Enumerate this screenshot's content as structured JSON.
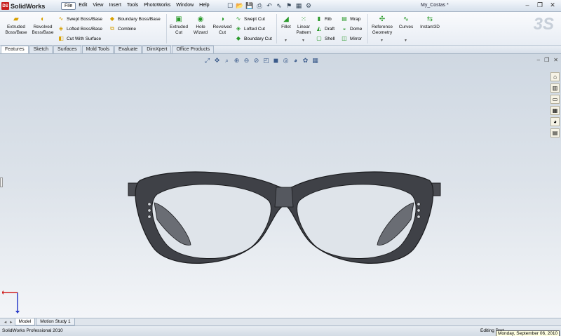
{
  "app": {
    "brand": "SolidWorks",
    "logo_text": "DS",
    "document_title": "My_Costas *"
  },
  "menu": [
    "File",
    "Edit",
    "View",
    "Insert",
    "Tools",
    "PhotoWorks",
    "Window",
    "Help"
  ],
  "ribbon": {
    "extruded_boss": "Extruded\nBoss/Base",
    "revolved_boss": "Revolved\nBoss/Base",
    "swept_boss": "Swept Boss/Base",
    "lofted_boss": "Lofted Boss/Base",
    "cut_with_surface": "Cut With Surface",
    "boundary_boss": "Boundary Boss/Base",
    "combine": "Combine",
    "extruded_cut": "Extruded\nCut",
    "hole_wizard": "Hole\nWizard",
    "revolved_cut": "Revolved\nCut",
    "swept_cut": "Swept Cut",
    "lofted_cut": "Lofted Cut",
    "boundary_cut": "Boundary Cut",
    "fillet": "Fillet",
    "linear_pattern": "Linear\nPattern",
    "rib": "Rib",
    "draft": "Draft",
    "shell": "Shell",
    "wrap": "Wrap",
    "dome": "Dome",
    "mirror": "Mirror",
    "reference_geometry": "Reference\nGeometry",
    "curves": "Curves",
    "instant3d": "Instant3D"
  },
  "tabs": [
    "Features",
    "Sketch",
    "Surfaces",
    "Mold Tools",
    "Evaluate",
    "DimXpert",
    "Office Products"
  ],
  "active_tab": "Features",
  "bottom_tabs": {
    "model": "Model",
    "motion_study": "Motion Study 1"
  },
  "status": {
    "product": "SolidWorks Professional 2010",
    "editing": "Editing Part",
    "tooltip": "Monday, September 06, 2010"
  },
  "colors": {
    "frame": "#3f4147",
    "frame_highlight": "#7a7d85",
    "accent_red": "#c81e1e"
  },
  "icons": {
    "new": "new-doc-icon",
    "open": "open-icon",
    "save": "save-icon",
    "print": "print-icon",
    "undo": "undo-icon",
    "select": "select-icon",
    "rebuild": "rebuild-icon",
    "options": "options-icon"
  }
}
